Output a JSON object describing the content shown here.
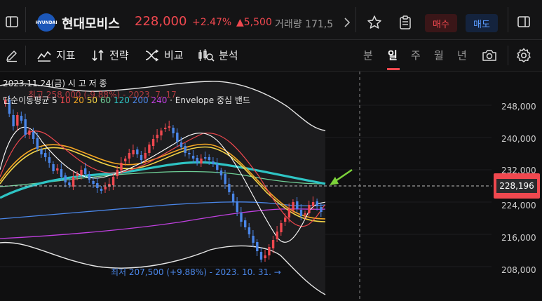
{
  "header": {
    "logo_text": "HYUNDAI",
    "stock_name": "현대모비스",
    "price": "228,000",
    "change_pct": "+2.47%",
    "change_abs": "▲5,500",
    "volume_label": "거래량 171,5",
    "buy_label": "매수",
    "sell_label": "매도"
  },
  "toolbar": {
    "tools": [
      {
        "label": "지표"
      },
      {
        "label": "전략"
      },
      {
        "label": "비교"
      },
      {
        "label": "분석"
      }
    ],
    "periods": [
      {
        "label": "분",
        "active": false
      },
      {
        "label": "일",
        "active": true
      },
      {
        "label": "주",
        "active": false
      },
      {
        "label": "월",
        "active": false
      },
      {
        "label": "년",
        "active": false
      }
    ]
  },
  "legend": {
    "date_line": "2023.11.24(금) 시 고 저 종",
    "ma_prefix": "단순이동평균 5",
    "ma_periods": [
      "10",
      "20",
      "50",
      "60",
      "120",
      "200",
      "240"
    ],
    "envelope": "· Envelope 중심 밴드",
    "high_annotation": "최고 258,000 (-9.88%) - 2023. 7. 17.",
    "low_annotation": "최저 207,500 (+9.88%) - 2023. 10. 31. →"
  },
  "axis": {
    "ticks": [
      "248,000",
      "240,000",
      "232,000",
      "224,000",
      "216,000",
      "208,000"
    ],
    "current_price_tag": "228,196"
  },
  "colors": {
    "up": "#f0484f",
    "down": "#4a86e8",
    "accent": "#f0484f",
    "ma5": "#ffffff",
    "ma10": "#f0484f",
    "ma20": "#f5a623",
    "ma50": "#f5d547",
    "ma60": "#6fcf97",
    "ma120": "#2ec4c4",
    "ma200": "#4a86e8",
    "ma240": "#c040e0",
    "envelope": "#e6e6e6"
  }
}
